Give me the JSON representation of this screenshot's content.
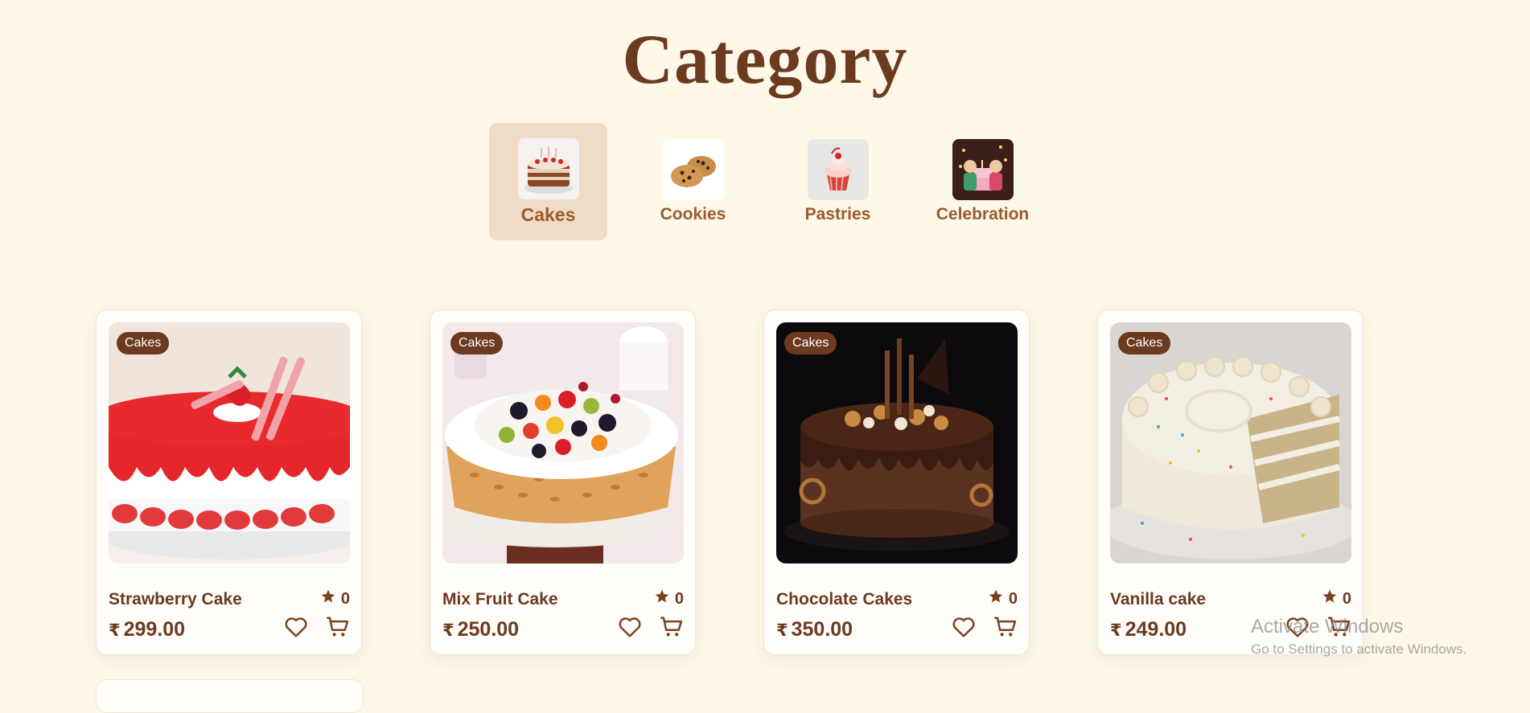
{
  "page": {
    "title": "Category"
  },
  "categories": [
    {
      "label": "Cakes",
      "icon": "cake-thumbnail",
      "active": true
    },
    {
      "label": "Cookies",
      "icon": "cookies-thumbnail",
      "active": false
    },
    {
      "label": "Pastries",
      "icon": "cupcake-thumbnail",
      "active": false
    },
    {
      "label": "Celebration",
      "icon": "celebration-thumbnail",
      "active": false
    }
  ],
  "products": [
    {
      "badge": "Cakes",
      "name": "Strawberry Cake",
      "rating": "0",
      "currency": "₹",
      "price": "299.00",
      "image": "strawberry-cake-image"
    },
    {
      "badge": "Cakes",
      "name": "Mix Fruit Cake",
      "rating": "0",
      "currency": "₹",
      "price": "250.00",
      "image": "mix-fruit-cake-image"
    },
    {
      "badge": "Cakes",
      "name": "Chocolate Cakes",
      "rating": "0",
      "currency": "₹",
      "price": "350.00",
      "image": "chocolate-cake-image"
    },
    {
      "badge": "Cakes",
      "name": "Vanilla cake",
      "rating": "0",
      "currency": "₹",
      "price": "249.00",
      "image": "vanilla-cake-image"
    }
  ],
  "watermark": {
    "line1": "Activate Windows",
    "line2": "Go to Settings to activate Windows."
  },
  "colors": {
    "background": "#fdf8e8",
    "brand_brown": "#6b3a1f",
    "active_category_bg": "#f0dcc6",
    "category_label": "#9a5a2f"
  }
}
